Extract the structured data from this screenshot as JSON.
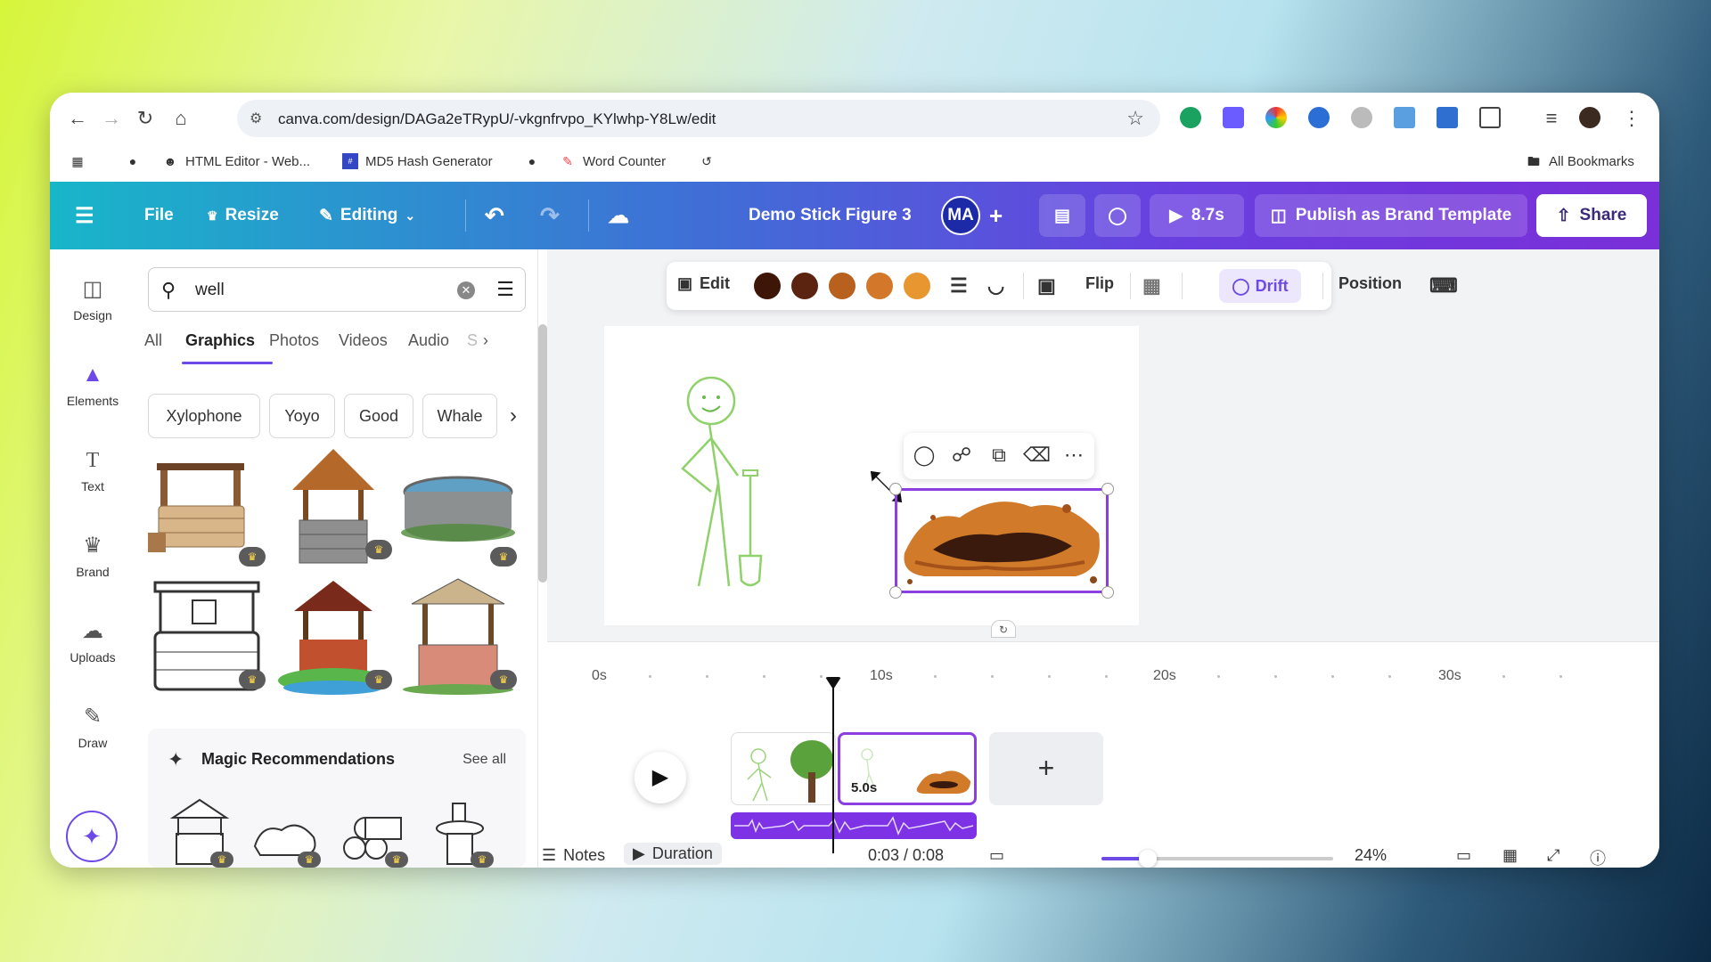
{
  "browser": {
    "url": "canva.com/design/DAGa2eTRypU/-vkgnfrvpo_KYlwhp-Y8Lw/edit",
    "bookmarks": [
      {
        "label": "HTML Editor - Web..."
      },
      {
        "label": "MD5 Hash Generator"
      },
      {
        "label": "Word Counter"
      }
    ],
    "all_bookmarks": "All Bookmarks"
  },
  "header": {
    "file": "File",
    "resize": "Resize",
    "editing": "Editing",
    "title": "Demo Stick Figure 3",
    "avatar": "MA",
    "play_time": "8.7s",
    "publish": "Publish as Brand Template",
    "share": "Share"
  },
  "rail": {
    "items": [
      {
        "label": "Design"
      },
      {
        "label": "Elements"
      },
      {
        "label": "Text"
      },
      {
        "label": "Brand"
      },
      {
        "label": "Uploads"
      },
      {
        "label": "Draw"
      }
    ]
  },
  "panel": {
    "search_value": "well",
    "tabs": [
      "All",
      "Graphics",
      "Photos",
      "Videos",
      "Audio",
      "S"
    ],
    "chips": [
      "Xylophone",
      "Yoyo",
      "Good",
      "Whale"
    ],
    "magic_title": "Magic Recommendations",
    "see_all": "See all"
  },
  "toolbar": {
    "edit": "Edit",
    "colors": [
      "#3d1608",
      "#5a2410",
      "#b8601e",
      "#d3782a",
      "#e8962f"
    ],
    "flip": "Flip",
    "drift": "Drift",
    "position": "Position"
  },
  "timeline": {
    "ticks": [
      "0s",
      "10s",
      "20s",
      "30s"
    ],
    "clip2_duration": "5.0s",
    "notes": "Notes",
    "duration": "Duration",
    "time": "0:03 / 0:08",
    "zoom": "24%",
    "zoom_fraction": 0.2
  }
}
